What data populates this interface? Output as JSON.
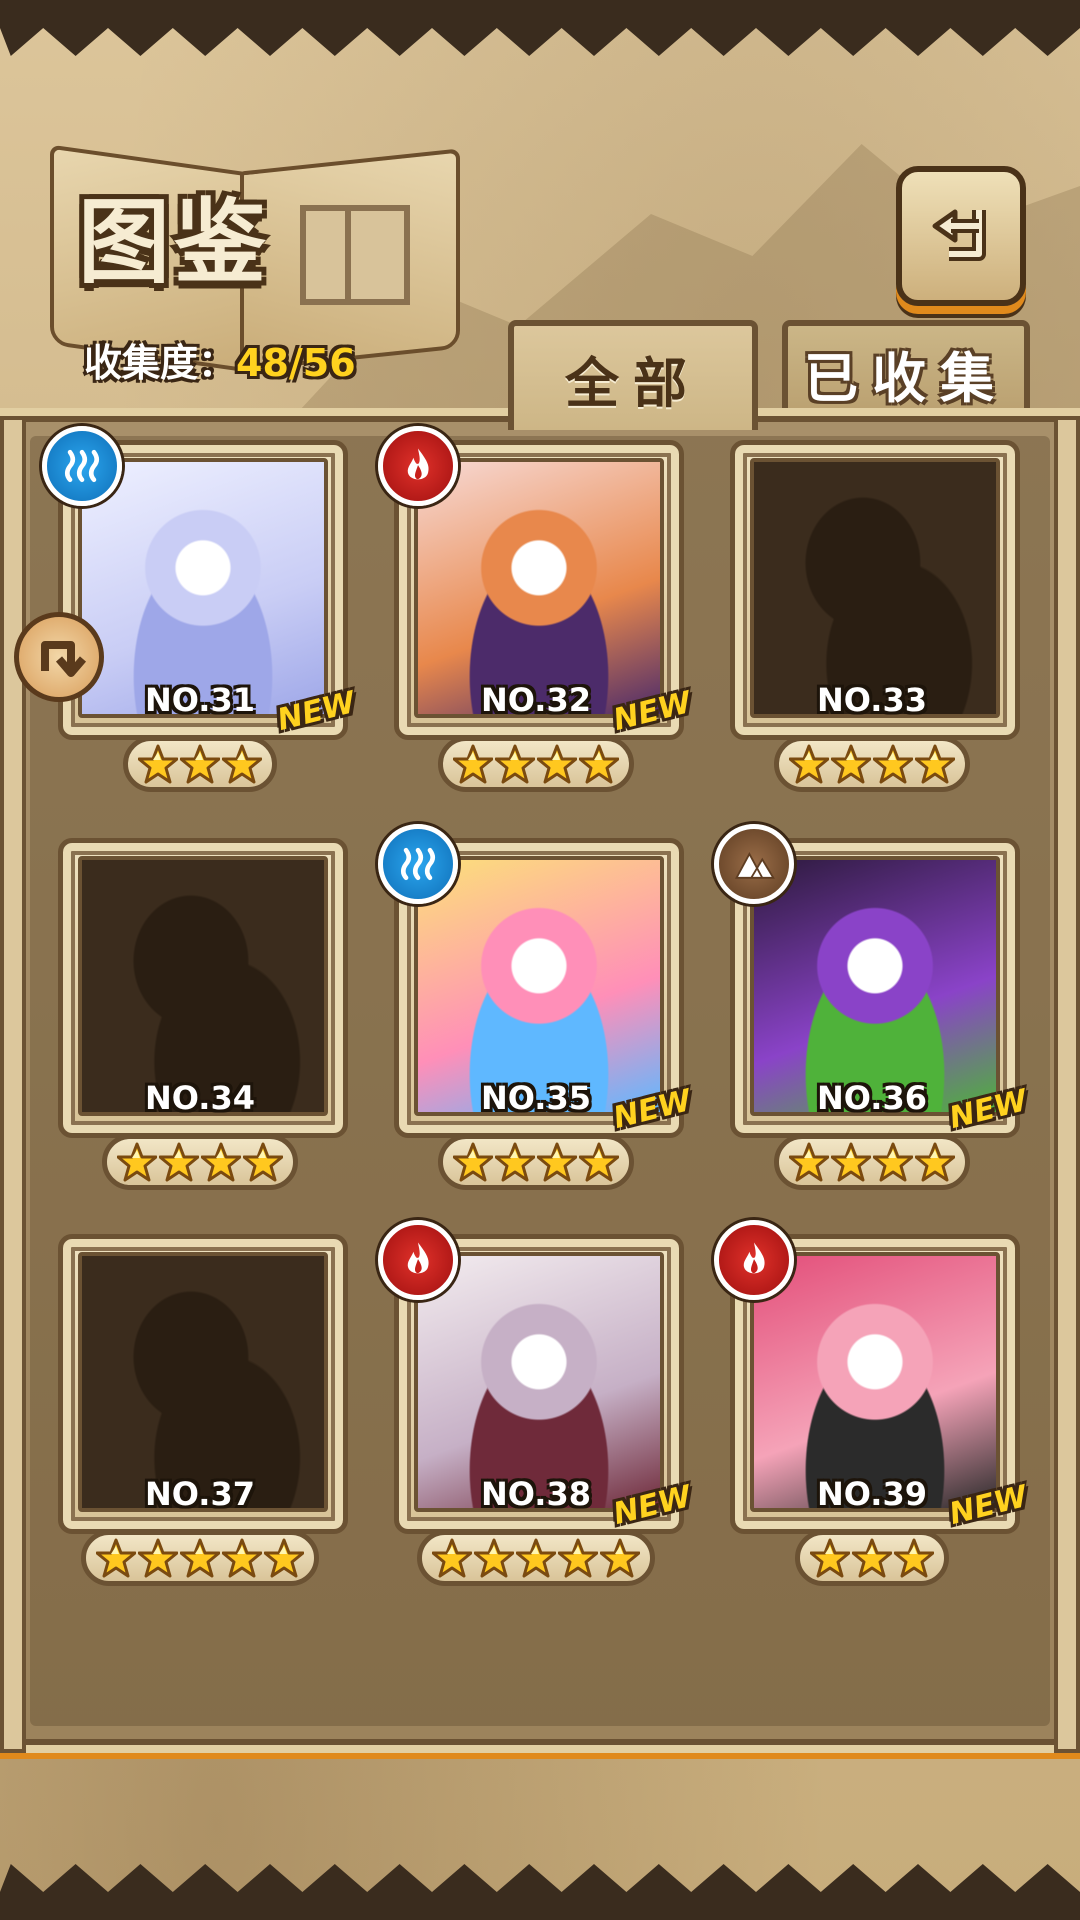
{
  "header": {
    "title": "图鉴",
    "collect_label": "收集度：",
    "collect_value": "48/56"
  },
  "tabs": [
    {
      "label": "全部",
      "active": true
    },
    {
      "label": "已收集",
      "active": false
    }
  ],
  "icons": {
    "back": "back-arrow-icon",
    "side": "swap-arrow-icon",
    "star": "star-icon"
  },
  "colors": {
    "water": "#1a86d6",
    "fire": "#c7201b",
    "earth": "#7a5535",
    "star": "#ffc81f",
    "new": "#ffd21f",
    "collect_value": "#ffd21f"
  },
  "cards": [
    {
      "number": "NO.31",
      "stars": 3,
      "attribute": "water",
      "new": "NEW",
      "locked": false,
      "palette": [
        "#eef0ff",
        "#c9cdf5",
        "#9ea7e8"
      ]
    },
    {
      "number": "NO.32",
      "stars": 4,
      "attribute": "fire",
      "new": "NEW",
      "locked": false,
      "palette": [
        "#f7d9d4",
        "#e8884c",
        "#4c2b6a"
      ]
    },
    {
      "number": "NO.33",
      "stars": 4,
      "attribute": "",
      "new": "",
      "locked": true,
      "palette": []
    },
    {
      "number": "NO.34",
      "stars": 4,
      "attribute": "",
      "new": "",
      "locked": true,
      "palette": []
    },
    {
      "number": "NO.35",
      "stars": 4,
      "attribute": "water",
      "new": "NEW",
      "locked": false,
      "palette": [
        "#fce07a",
        "#ff8fb8",
        "#5fb8ff"
      ]
    },
    {
      "number": "NO.36",
      "stars": 4,
      "attribute": "earth",
      "new": "NEW",
      "locked": false,
      "palette": [
        "#2d1a3d",
        "#8a43c8",
        "#4fb23a"
      ]
    },
    {
      "number": "NO.37",
      "stars": 5,
      "attribute": "",
      "new": "",
      "locked": true,
      "palette": []
    },
    {
      "number": "NO.38",
      "stars": 5,
      "attribute": "fire",
      "new": "NEW",
      "locked": false,
      "palette": [
        "#f3ecef",
        "#c6b0c6",
        "#6f2a3a"
      ]
    },
    {
      "number": "NO.39",
      "stars": 3,
      "attribute": "fire",
      "new": "NEW",
      "locked": false,
      "palette": [
        "#e34f7a",
        "#f5a3b8",
        "#2b2b2b"
      ]
    }
  ]
}
